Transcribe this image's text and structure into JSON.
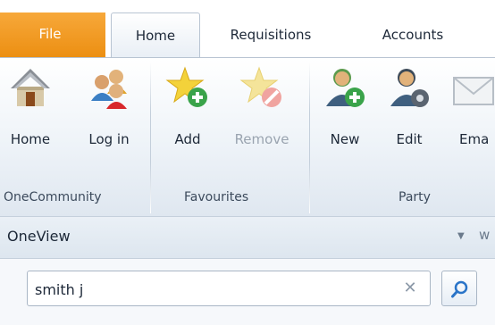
{
  "tabs": {
    "file": "File",
    "home": "Home",
    "requisitions": "Requisitions",
    "accounts": "Accounts"
  },
  "ribbon": {
    "groups": {
      "onecommunity": {
        "label": "OneCommunity",
        "buttons": {
          "home": "Home",
          "login": "Log in"
        }
      },
      "favourites": {
        "label": "Favourites",
        "buttons": {
          "add": "Add",
          "remove": "Remove"
        }
      },
      "party": {
        "label": "Party",
        "buttons": {
          "new": "New",
          "edit": "Edit",
          "email": "Ema"
        }
      }
    }
  },
  "pane": {
    "title": "OneView",
    "search": {
      "value": "smith j"
    }
  },
  "colors": {
    "file_tab": "#ec8f12",
    "accent": "#2a74c8"
  }
}
